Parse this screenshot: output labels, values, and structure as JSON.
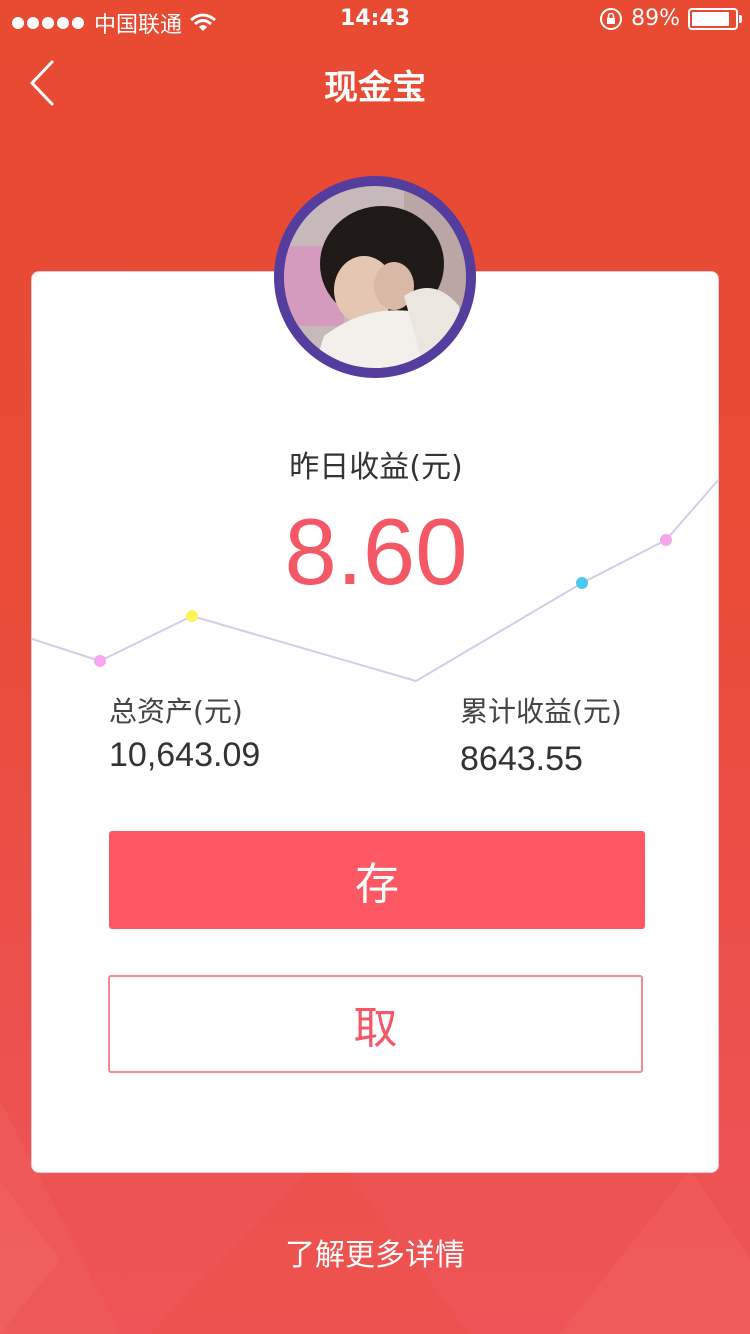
{
  "status_bar": {
    "carrier": "中国联通",
    "time": "14:43",
    "battery_percent": "89%",
    "battery_level": 0.89
  },
  "nav": {
    "title": "现金宝",
    "back_icon": "chevron-left-icon"
  },
  "summary": {
    "yesterday_label": "昨日收益(元)",
    "yesterday_value": "8.60",
    "total_assets_label": "总资产(元)",
    "total_assets_value": "10,643.09",
    "cumulative_label": "累计收益(元)",
    "cumulative_value": "8643.55"
  },
  "actions": {
    "deposit_label": "存",
    "withdraw_label": "取"
  },
  "footer": {
    "more_label": "了解更多详情"
  },
  "colors": {
    "accent": "#fd5863",
    "value_red": "#f45867",
    "avatar_ring": "#553d9e",
    "trend_line": "#d4cdea",
    "dot_pink": "#f7a6ee",
    "dot_yellow": "#fff35a",
    "dot_blue": "#4cc8f1"
  }
}
